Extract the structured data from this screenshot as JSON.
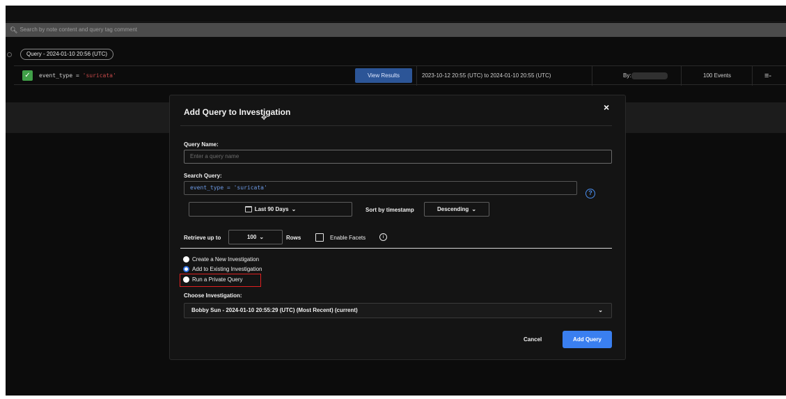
{
  "search": {
    "placeholder": "Search by note content and query tag comment",
    "icon": "search-icon"
  },
  "query_tag": {
    "label": "Query - 2024-01-10 20:56 (UTC)"
  },
  "query_row": {
    "query_prefix": "event_type = ",
    "query_value": "'suricata'",
    "view_results": "View Results",
    "date_range": "2023-10-12 20:55 (UTC) to 2024-01-10 20:55 (UTC)",
    "by_label": "By:",
    "events": "100 Events",
    "menu_icon": "≡-"
  },
  "modal": {
    "title": "Add Query to Investigation",
    "close": "×",
    "query_name_label": "Query Name:",
    "query_name_placeholder": "Enter a query name",
    "search_query_label": "Search Query:",
    "search_query_value": "event_type = 'suricata'",
    "help": "?",
    "time_range": "Last 90 Days",
    "sort_label": "Sort by timestamp",
    "sort_value": "Descending",
    "retrieve_label": "Retrieve up to",
    "rows_value": "100",
    "rows_label": "Rows",
    "facets_label": "Enable Facets",
    "info": "i",
    "options": [
      {
        "label": "Create a New Investigation",
        "selected": false
      },
      {
        "label": "Add to Existing Investigation",
        "selected": true
      },
      {
        "label": "Run a Private Query",
        "selected": false
      }
    ],
    "choose_label": "Choose Investigation:",
    "investigation_value": "Bobby Sun - 2024-01-10 20:55:29 (UTC) (Most Recent) (current)",
    "cancel": "Cancel",
    "add_query": "Add Query"
  },
  "colors": {
    "accent": "#3a7ff0",
    "view_results_bg": "#2c5597",
    "highlight": "#e02020",
    "check_green": "#40a048"
  }
}
